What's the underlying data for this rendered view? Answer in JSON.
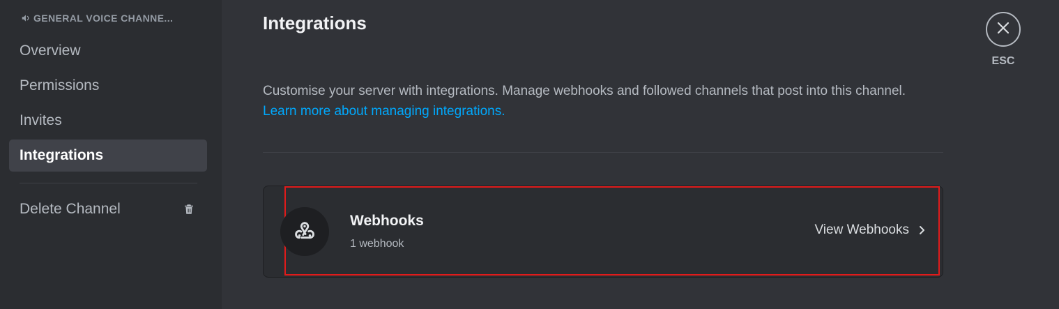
{
  "sidebar": {
    "header": "GENERAL VOICE CHANNE...",
    "items": [
      {
        "label": "Overview",
        "selected": false
      },
      {
        "label": "Permissions",
        "selected": false
      },
      {
        "label": "Invites",
        "selected": false
      },
      {
        "label": "Integrations",
        "selected": true
      }
    ],
    "delete_label": "Delete Channel"
  },
  "main": {
    "title": "Integrations",
    "description": "Customise your server with integrations. Manage webhooks and followed channels that post into this channel.",
    "learn_more": "Learn more about managing integrations.",
    "card": {
      "title": "Webhooks",
      "count": "1 webhook",
      "action": "View Webhooks",
      "icon": "webhook-icon"
    }
  },
  "close": {
    "label": "ESC",
    "icon": "close-icon"
  },
  "colors": {
    "background": "#313338",
    "sidebar": "#2b2d31",
    "selected": "#404249",
    "link": "#00a8fc",
    "highlight": "#e01b1b"
  }
}
